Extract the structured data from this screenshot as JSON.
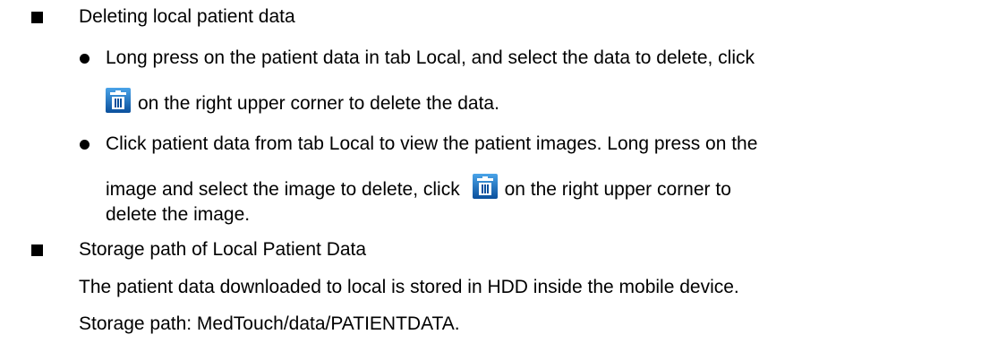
{
  "section1": {
    "heading": "Deleting local patient data",
    "bullet1": {
      "line1": "Long press on the patient data in tab Local, and select the data to delete, click",
      "line2_after_icon": "on the right upper corner to delete the data."
    },
    "bullet2": {
      "line1": "Click patient data from tab Local to view the patient images. Long press on the",
      "line2_before_icon": "image and select the image to delete, click",
      "line2_after_icon": "on the right upper corner to",
      "line3": "delete the image."
    }
  },
  "section2": {
    "heading": "Storage path of Local Patient Data",
    "para1": "The patient data downloaded to local is stored in HDD inside the mobile device.",
    "para2": "Storage path: MedTouch/data/PATIENTDATA."
  },
  "icons": {
    "delete": "trash-icon"
  },
  "colors": {
    "icon_top": "#3a8fd6",
    "icon_bottom": "#0a4f9c",
    "text": "#000000"
  }
}
